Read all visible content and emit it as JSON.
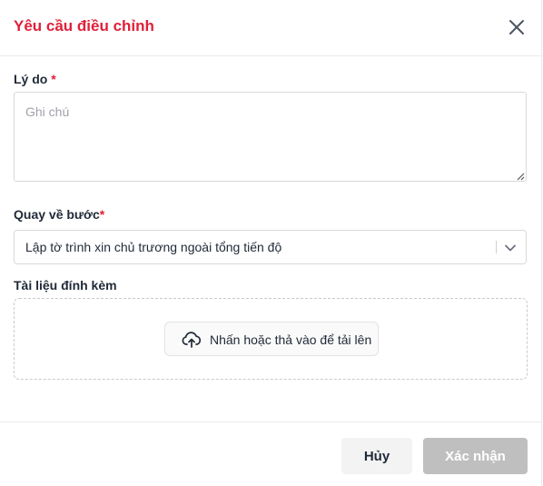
{
  "dialog": {
    "title": "Yêu cầu điều chỉnh",
    "close_icon": "close-icon"
  },
  "reason": {
    "label": "Lý do",
    "required_mark": "*",
    "placeholder": "Ghi chú",
    "value": ""
  },
  "return_step": {
    "label": "Quay về bước",
    "required_mark": "*",
    "selected": "Lập tờ trình xin chủ trương ngoài tổng tiến độ",
    "chevron_icon": "chevron-down-icon"
  },
  "attachments": {
    "label": "Tài liệu đính kèm",
    "upload_label": "Nhấn hoặc thả vào để tải lên",
    "upload_icon": "cloud-upload-icon"
  },
  "footer": {
    "cancel_label": "Hủy",
    "confirm_label": "Xác nhận"
  },
  "colors": {
    "accent": "#e0203a",
    "disabled_button": "#bfbfbf",
    "secondary_button": "#f3f3f3"
  }
}
